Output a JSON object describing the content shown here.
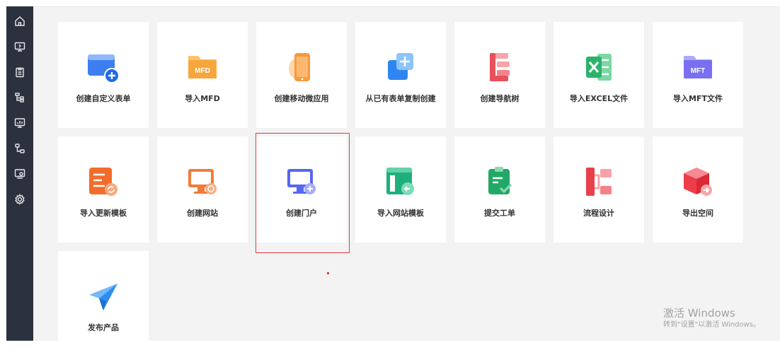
{
  "sidebar": {
    "items": [
      {
        "icon": "home-icon"
      },
      {
        "icon": "monitor-arrow-icon"
      },
      {
        "icon": "clipboard-icon"
      },
      {
        "icon": "tree-structure-icon"
      },
      {
        "icon": "monitor-chart-icon"
      },
      {
        "icon": "flow-nodes-icon"
      },
      {
        "icon": "monitor-settings-icon"
      },
      {
        "icon": "gear-icon"
      }
    ]
  },
  "cards": [
    {
      "label": "创建自定义表单",
      "icon": "form-add-icon",
      "color": "#3d7ef2"
    },
    {
      "label": "导入MFD",
      "icon": "mfd-folder-icon",
      "color": "#f7a63b"
    },
    {
      "label": "创建移动微应用",
      "icon": "mobile-app-icon",
      "color": "#f79a3b"
    },
    {
      "label": "从已有表单复制创建",
      "icon": "copy-form-icon",
      "color": "#2f86f0"
    },
    {
      "label": "创建导航树",
      "icon": "navigation-tree-icon",
      "color": "#e8505b"
    },
    {
      "label": "导入EXCEL文件",
      "icon": "excel-file-icon",
      "color": "#2bb36b"
    },
    {
      "label": "导入MFT文件",
      "icon": "mft-folder-icon",
      "color": "#7a6ff0"
    },
    {
      "label": "导入更新模板",
      "icon": "update-template-icon",
      "color": "#f26d2b"
    },
    {
      "label": "创建网站",
      "icon": "website-icon",
      "color": "#f07c3b"
    },
    {
      "label": "创建门户",
      "icon": "portal-icon",
      "color": "#5667f0"
    },
    {
      "label": "导入网站模板",
      "icon": "website-template-icon",
      "color": "#1faf7a"
    },
    {
      "label": "提交工单",
      "icon": "ticket-submit-icon",
      "color": "#22a866"
    },
    {
      "label": "流程设计",
      "icon": "process-design-icon",
      "color": "#e8404b"
    },
    {
      "label": "导出空间",
      "icon": "export-space-icon",
      "color": "#ee3c48"
    },
    {
      "label": "发布产品",
      "icon": "paper-plane-icon",
      "color": "#2d8ef0"
    }
  ],
  "watermark": {
    "line1": "激活 Windows",
    "line2": "转到\"设置\"以激活 Windows。"
  }
}
